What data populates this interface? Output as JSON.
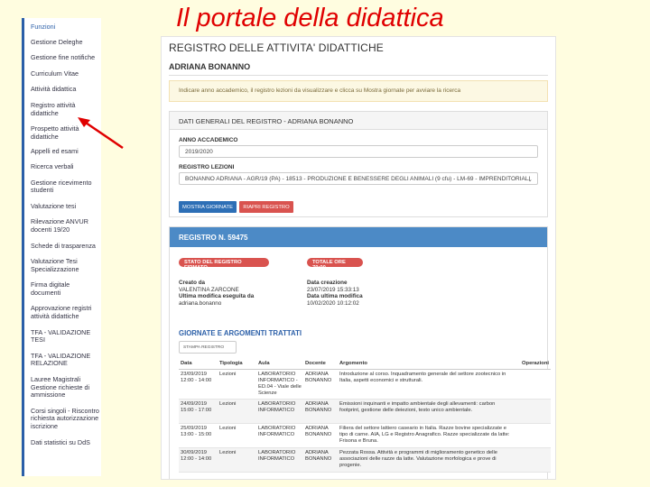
{
  "slide_title": "Il portale della didattica",
  "sidebar": {
    "items": [
      {
        "label": "Funzioni",
        "active": true
      },
      {
        "label": "Gestione Deleghe"
      },
      {
        "label": "Gestione fine notifiche"
      },
      {
        "label": "Curriculum Vitae"
      },
      {
        "label": "Attività didattica"
      },
      {
        "label": "Registro attività didattiche"
      },
      {
        "label": "Prospetto attività didattiche"
      },
      {
        "label": "Appelli ed esami"
      },
      {
        "label": "Ricerca verbali"
      },
      {
        "label": "Gestione ricevimento studenti"
      },
      {
        "label": "Valutazione tesi"
      },
      {
        "label": "Rilevazione ANVUR docenti 19/20"
      },
      {
        "label": "Schede di trasparenza"
      },
      {
        "label": "Valutazione Tesi Specializzazione"
      },
      {
        "label": "Firma digitale documenti"
      },
      {
        "label": "Approvazione registri attività didattiche"
      },
      {
        "label": "TFA - VALIDAZIONE TESI"
      },
      {
        "label": "TFA - VALIDAZIONE RELAZIONE"
      },
      {
        "label": "Lauree Magistrali Gestione richieste di ammissione"
      },
      {
        "label": "Corsi singoli - Riscontro richiesta autorizzazione iscrizione"
      },
      {
        "label": "Dati statistici su DdS"
      }
    ]
  },
  "main": {
    "title": "REGISTRO DELLE ATTIVITA' DIDATTICHE",
    "teacher": "ADRIANA BONANNO",
    "notice": "Indicare anno accademico, il registro lezioni da visualizzare e clicca su Mostra giornate per avviare la ricerca",
    "general": {
      "header": "DATI GENERALI DEL REGISTRO - ADRIANA BONANNO",
      "year_label": "ANNO ACCADEMICO",
      "year_value": "2019/2020",
      "register_label": "REGISTRO LEZIONI",
      "register_value": "BONANNO ADRIANA - AGR/19 (PA) - 18513 - PRODUZIONE E BENESSERE DEGLI ANIMALI (9 cfu) - LM-69 - IMPRENDITORIALI",
      "btn_show": "MOSTRA GIORNATE",
      "btn_reopen": "RIAPRI REGISTRO"
    },
    "register": {
      "header": "REGISTRO N. 59475",
      "status_badge": "STATO DEL REGISTRO FIRMATO",
      "hours_badge": "TOTALE ORE 79:00",
      "created_by_label": "Creato da",
      "created_by": "VALENTINA ZARCONE",
      "last_modified_by_label": "Ultima modifica eseguita da",
      "last_modified_by": "adriana.bonanno",
      "created_date_label": "Data creazione",
      "created_date": "23/07/2019 15:33:13",
      "last_modified_date_label": "Data ultima modifica",
      "last_modified_date": "10/02/2020 10:12:02",
      "giornate_title": "GIORNATE E ARGOMENTI TRATTATI",
      "print_button": "STAMPA REGISTRO",
      "columns": [
        "Data",
        "Tipologia",
        "Aula",
        "Docente",
        "Argomento",
        "Operazioni"
      ],
      "rows": [
        {
          "data": "23/09/2019 12:00 - 14:00",
          "tipologia": "Lezioni",
          "aula": "LABORATORIO INFORMATICO - ED.04 - Viale delle Scienze",
          "docente": "ADRIANA BONANNO",
          "argomento": "Introduzione al corso. Inquadramento generale del settore zootecnico in Italia, aspetti economici e strutturali.",
          "operazioni": ""
        },
        {
          "data": "24/09/2019 15:00 - 17:00",
          "tipologia": "Lezioni",
          "aula": "LABORATORIO INFORMATICO",
          "docente": "ADRIANA BONANNO",
          "argomento": "Emissioni inquinanti e impatto ambientale degli allevamenti: carbon footprint, gestione delle deiezioni, testo unico ambientale.",
          "operazioni": ""
        },
        {
          "data": "25/09/2019 13:00 - 15:00",
          "tipologia": "Lezioni",
          "aula": "LABORATORIO INFORMATICO",
          "docente": "ADRIANA BONANNO",
          "argomento": "Filiera del settore lattiero caseario in Italia. Razze bovine specializzate e tipo di carne. AIA, LG e Registro Anagrafico. Razze specializzate da latte: Frisona e Bruna.",
          "operazioni": ""
        },
        {
          "data": "30/09/2019 12:00 - 14:00",
          "tipologia": "Lezioni",
          "aula": "LABORATORIO INFORMATICO",
          "docente": "ADRIANA BONANNO",
          "argomento": "Pezzata Rossa. Attività e programmi di miglioramento genetico delle associazioni delle razze da latte. Valutazione morfologica e prove di progenie.",
          "operazioni": ""
        }
      ]
    }
  },
  "colors": {
    "slide_bg": "#fffde0",
    "title_red": "#e00000",
    "accent_blue": "#2d6fb6",
    "danger_red": "#d9534f",
    "header_blue": "#4c8ac6"
  }
}
